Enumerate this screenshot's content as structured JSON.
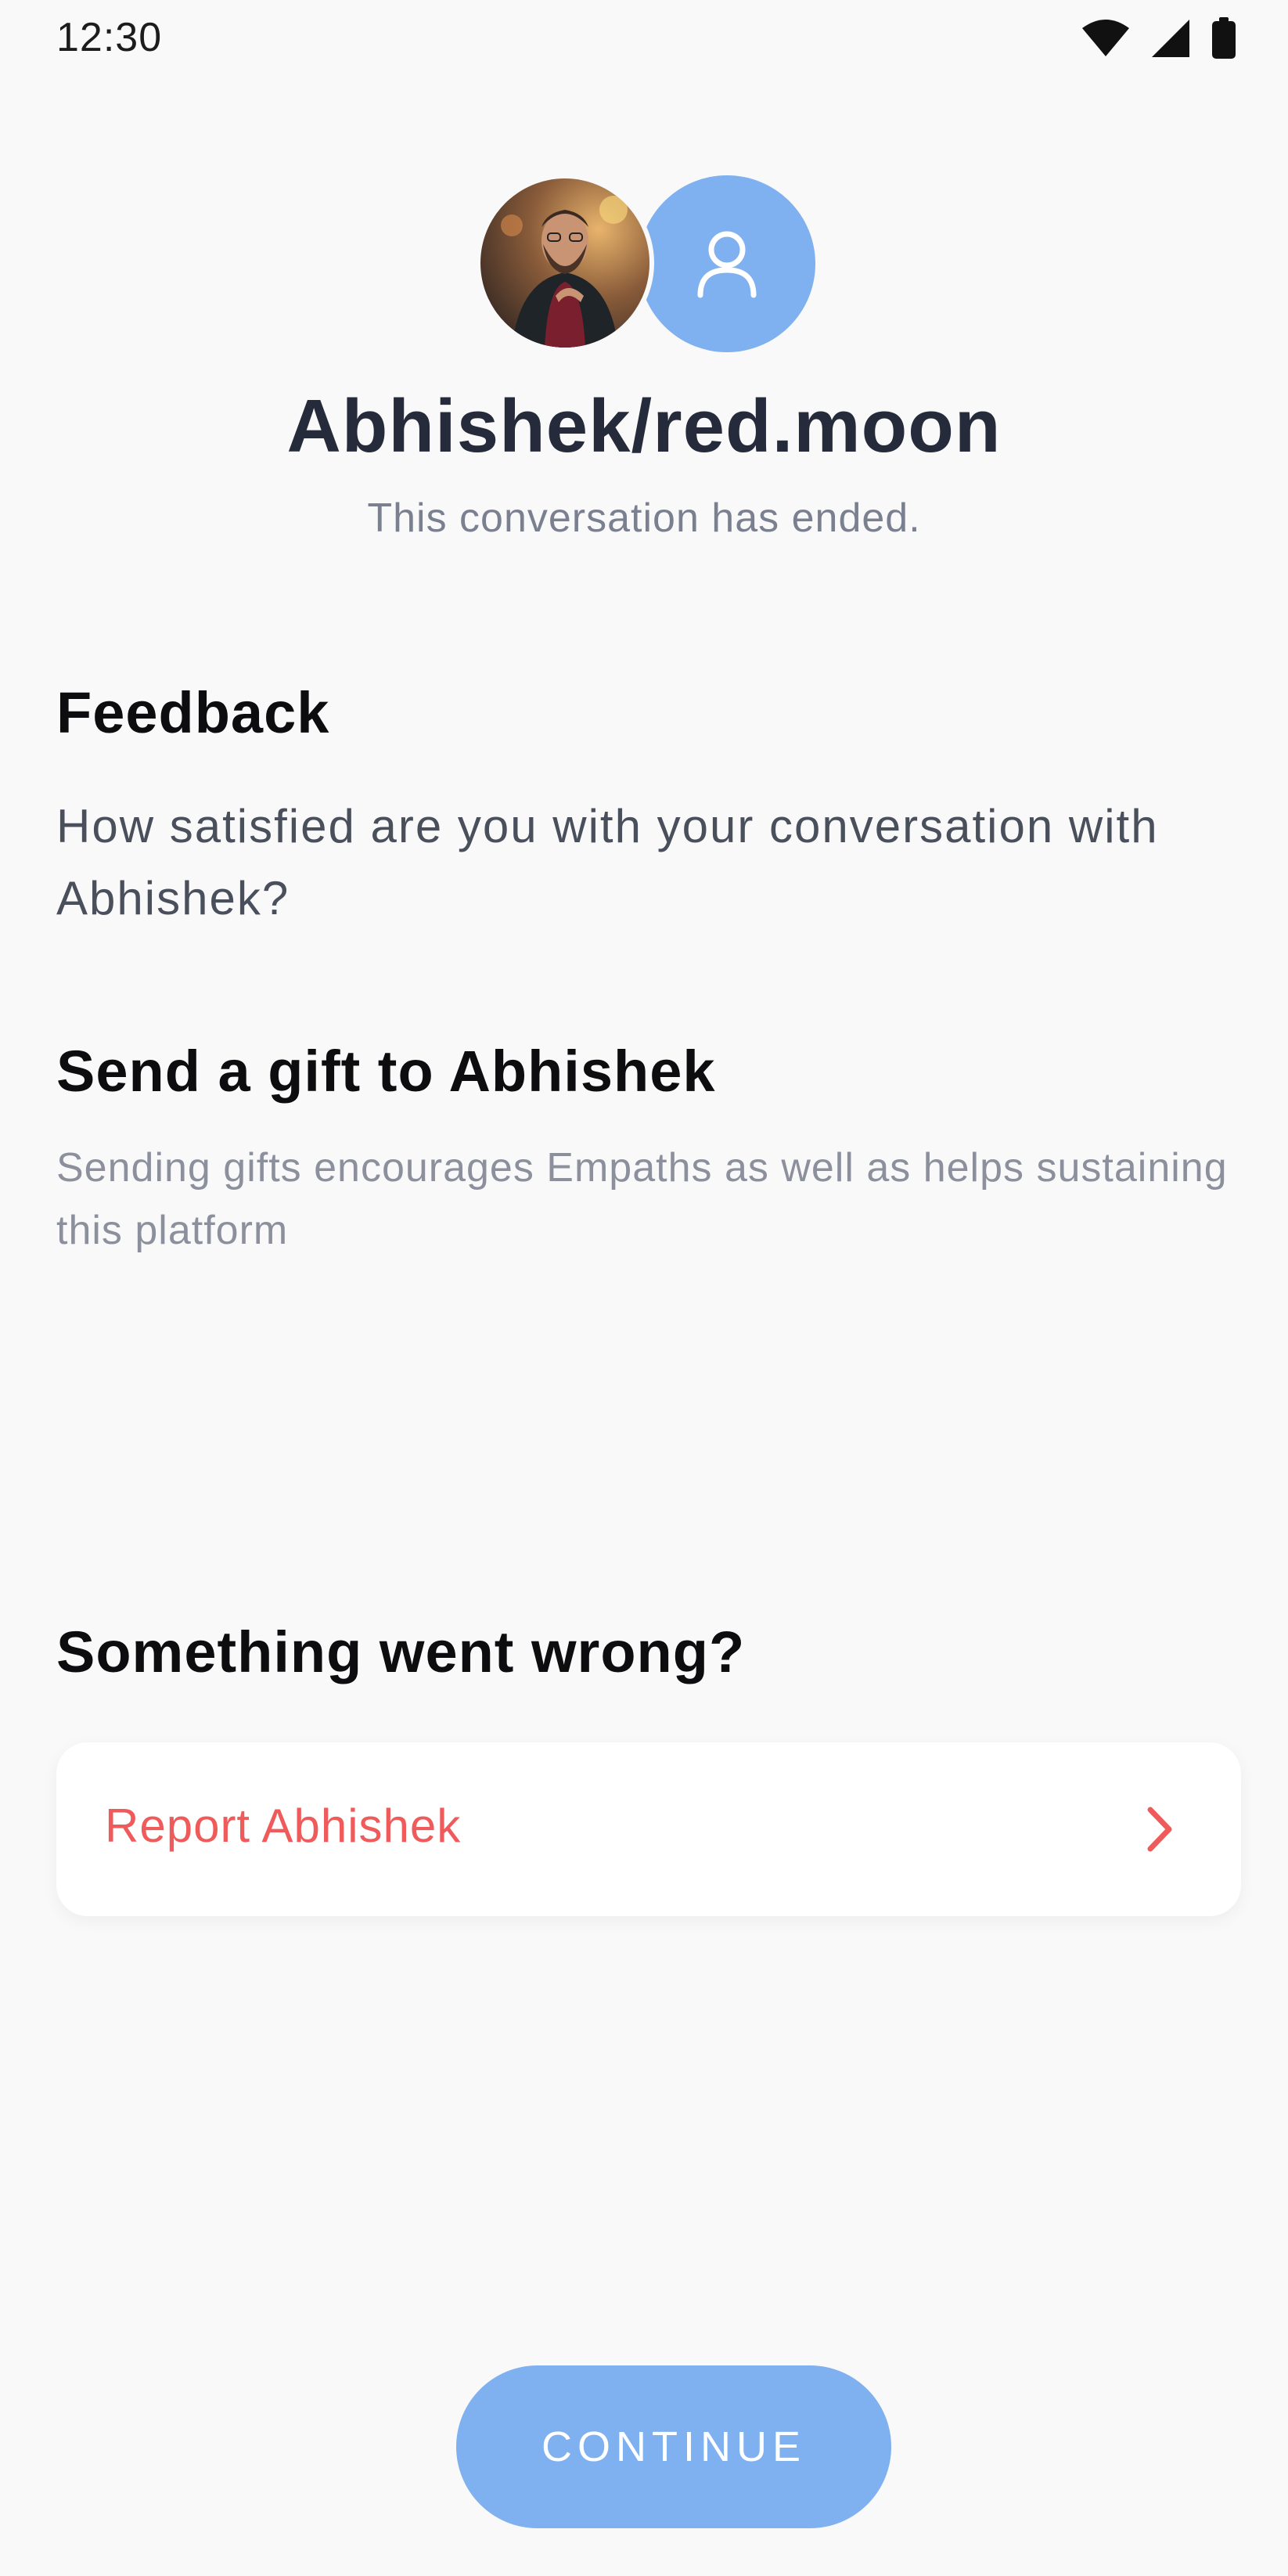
{
  "status_bar": {
    "time": "12:30",
    "icons": [
      "wifi-icon",
      "signal-icon",
      "battery-icon"
    ]
  },
  "header": {
    "avatars": [
      "profile-photo",
      "user-icon"
    ],
    "title": "Abhishek/red.moon",
    "subtitle": "This conversation has ended."
  },
  "feedback": {
    "heading": "Feedback",
    "question": "How satisfied are you with your conversation with Abhishek?"
  },
  "gift": {
    "heading": "Send a gift to Abhishek",
    "description": "Sending gifts encourages Empaths  as well as helps sustaining this platform"
  },
  "problem": {
    "heading": "Something went wrong?",
    "report_label": "Report Abhishek",
    "report_icon": "chevron-right-icon"
  },
  "actions": {
    "continue_label": "CONTINUE"
  },
  "colors": {
    "accent": "#7fb0ef",
    "report_text": "#ef5a5a",
    "background": "#f9f9fa"
  }
}
